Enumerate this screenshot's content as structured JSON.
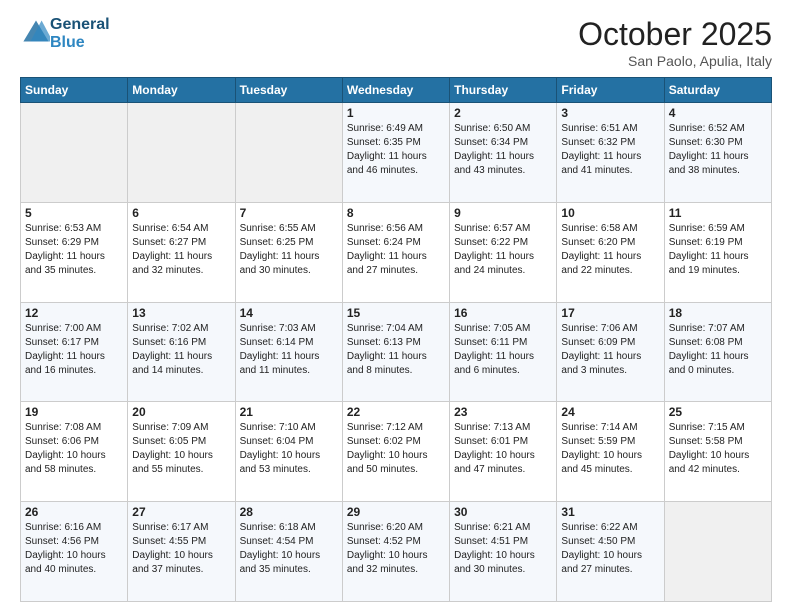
{
  "header": {
    "logo_general": "General",
    "logo_blue": "Blue",
    "month_title": "October 2025",
    "location": "San Paolo, Apulia, Italy"
  },
  "days_of_week": [
    "Sunday",
    "Monday",
    "Tuesday",
    "Wednesday",
    "Thursday",
    "Friday",
    "Saturday"
  ],
  "weeks": [
    [
      {
        "num": "",
        "info": ""
      },
      {
        "num": "",
        "info": ""
      },
      {
        "num": "",
        "info": ""
      },
      {
        "num": "1",
        "info": "Sunrise: 6:49 AM\nSunset: 6:35 PM\nDaylight: 11 hours\nand 46 minutes."
      },
      {
        "num": "2",
        "info": "Sunrise: 6:50 AM\nSunset: 6:34 PM\nDaylight: 11 hours\nand 43 minutes."
      },
      {
        "num": "3",
        "info": "Sunrise: 6:51 AM\nSunset: 6:32 PM\nDaylight: 11 hours\nand 41 minutes."
      },
      {
        "num": "4",
        "info": "Sunrise: 6:52 AM\nSunset: 6:30 PM\nDaylight: 11 hours\nand 38 minutes."
      }
    ],
    [
      {
        "num": "5",
        "info": "Sunrise: 6:53 AM\nSunset: 6:29 PM\nDaylight: 11 hours\nand 35 minutes."
      },
      {
        "num": "6",
        "info": "Sunrise: 6:54 AM\nSunset: 6:27 PM\nDaylight: 11 hours\nand 32 minutes."
      },
      {
        "num": "7",
        "info": "Sunrise: 6:55 AM\nSunset: 6:25 PM\nDaylight: 11 hours\nand 30 minutes."
      },
      {
        "num": "8",
        "info": "Sunrise: 6:56 AM\nSunset: 6:24 PM\nDaylight: 11 hours\nand 27 minutes."
      },
      {
        "num": "9",
        "info": "Sunrise: 6:57 AM\nSunset: 6:22 PM\nDaylight: 11 hours\nand 24 minutes."
      },
      {
        "num": "10",
        "info": "Sunrise: 6:58 AM\nSunset: 6:20 PM\nDaylight: 11 hours\nand 22 minutes."
      },
      {
        "num": "11",
        "info": "Sunrise: 6:59 AM\nSunset: 6:19 PM\nDaylight: 11 hours\nand 19 minutes."
      }
    ],
    [
      {
        "num": "12",
        "info": "Sunrise: 7:00 AM\nSunset: 6:17 PM\nDaylight: 11 hours\nand 16 minutes."
      },
      {
        "num": "13",
        "info": "Sunrise: 7:02 AM\nSunset: 6:16 PM\nDaylight: 11 hours\nand 14 minutes."
      },
      {
        "num": "14",
        "info": "Sunrise: 7:03 AM\nSunset: 6:14 PM\nDaylight: 11 hours\nand 11 minutes."
      },
      {
        "num": "15",
        "info": "Sunrise: 7:04 AM\nSunset: 6:13 PM\nDaylight: 11 hours\nand 8 minutes."
      },
      {
        "num": "16",
        "info": "Sunrise: 7:05 AM\nSunset: 6:11 PM\nDaylight: 11 hours\nand 6 minutes."
      },
      {
        "num": "17",
        "info": "Sunrise: 7:06 AM\nSunset: 6:09 PM\nDaylight: 11 hours\nand 3 minutes."
      },
      {
        "num": "18",
        "info": "Sunrise: 7:07 AM\nSunset: 6:08 PM\nDaylight: 11 hours\nand 0 minutes."
      }
    ],
    [
      {
        "num": "19",
        "info": "Sunrise: 7:08 AM\nSunset: 6:06 PM\nDaylight: 10 hours\nand 58 minutes."
      },
      {
        "num": "20",
        "info": "Sunrise: 7:09 AM\nSunset: 6:05 PM\nDaylight: 10 hours\nand 55 minutes."
      },
      {
        "num": "21",
        "info": "Sunrise: 7:10 AM\nSunset: 6:04 PM\nDaylight: 10 hours\nand 53 minutes."
      },
      {
        "num": "22",
        "info": "Sunrise: 7:12 AM\nSunset: 6:02 PM\nDaylight: 10 hours\nand 50 minutes."
      },
      {
        "num": "23",
        "info": "Sunrise: 7:13 AM\nSunset: 6:01 PM\nDaylight: 10 hours\nand 47 minutes."
      },
      {
        "num": "24",
        "info": "Sunrise: 7:14 AM\nSunset: 5:59 PM\nDaylight: 10 hours\nand 45 minutes."
      },
      {
        "num": "25",
        "info": "Sunrise: 7:15 AM\nSunset: 5:58 PM\nDaylight: 10 hours\nand 42 minutes."
      }
    ],
    [
      {
        "num": "26",
        "info": "Sunrise: 6:16 AM\nSunset: 4:56 PM\nDaylight: 10 hours\nand 40 minutes."
      },
      {
        "num": "27",
        "info": "Sunrise: 6:17 AM\nSunset: 4:55 PM\nDaylight: 10 hours\nand 37 minutes."
      },
      {
        "num": "28",
        "info": "Sunrise: 6:18 AM\nSunset: 4:54 PM\nDaylight: 10 hours\nand 35 minutes."
      },
      {
        "num": "29",
        "info": "Sunrise: 6:20 AM\nSunset: 4:52 PM\nDaylight: 10 hours\nand 32 minutes."
      },
      {
        "num": "30",
        "info": "Sunrise: 6:21 AM\nSunset: 4:51 PM\nDaylight: 10 hours\nand 30 minutes."
      },
      {
        "num": "31",
        "info": "Sunrise: 6:22 AM\nSunset: 4:50 PM\nDaylight: 10 hours\nand 27 minutes."
      },
      {
        "num": "",
        "info": ""
      }
    ]
  ]
}
